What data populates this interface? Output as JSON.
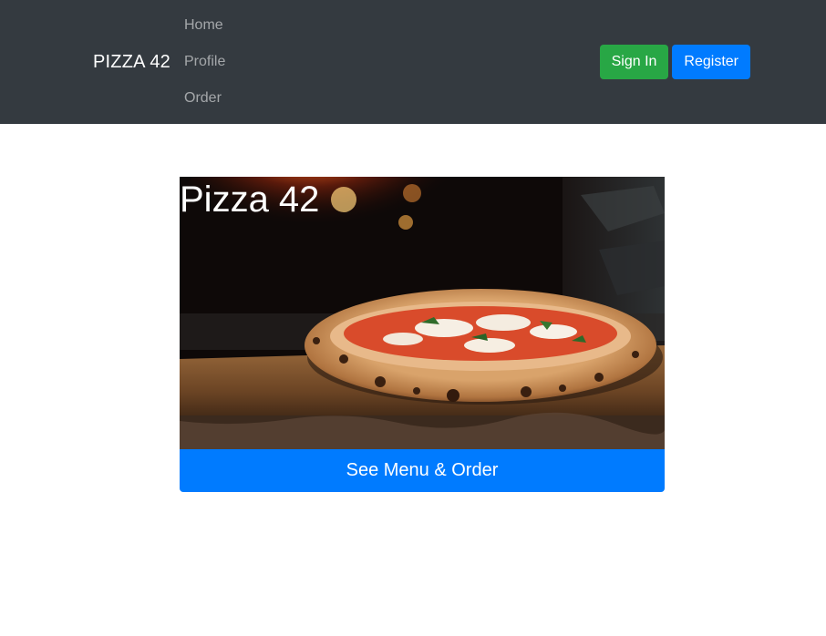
{
  "navbar": {
    "brand": "PIZZA 42",
    "links": [
      {
        "label": "Home"
      },
      {
        "label": "Profile"
      },
      {
        "label": "Order"
      }
    ],
    "sign_in_label": "Sign In",
    "register_label": "Register"
  },
  "hero": {
    "title": "Pizza 42",
    "image_subject": "wood-fired pizza on a wooden board in front of a brick oven"
  },
  "cta": {
    "label": "See Menu & Order"
  },
  "colors": {
    "navbar_bg": "#343a40",
    "primary": "#007bff",
    "success": "#28a745"
  }
}
